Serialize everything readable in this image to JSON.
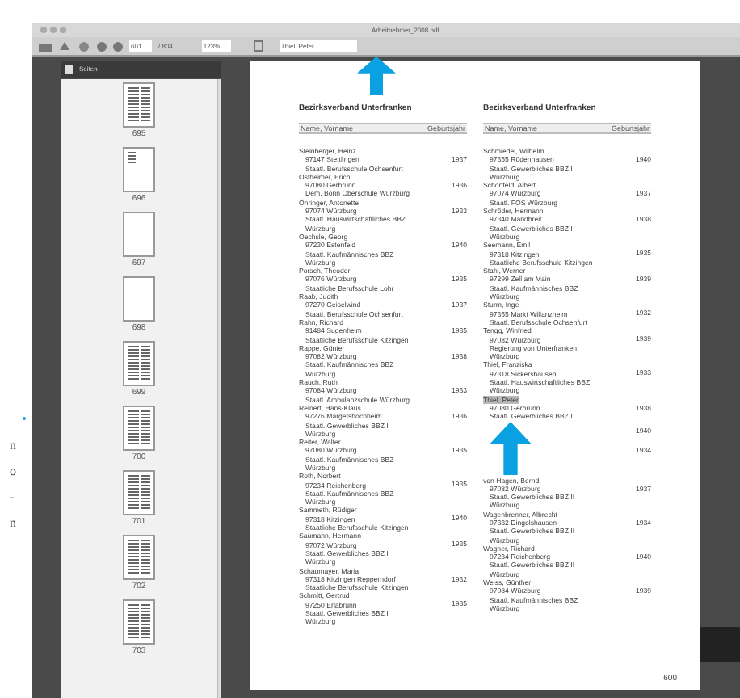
{
  "window": {
    "title": "Arbeitnehmer_2008.pdf"
  },
  "toolbar": {
    "page": "601",
    "page_count": "/ 804",
    "zoom": "123%",
    "search": "Thiel, Peter"
  },
  "sidebar": {
    "title": "Seiten",
    "thumbnails": [
      {
        "label": "695",
        "kind": "list"
      },
      {
        "label": "696",
        "kind": "partial"
      },
      {
        "label": "697",
        "kind": "blank"
      },
      {
        "label": "698",
        "kind": "blank"
      },
      {
        "label": "699",
        "kind": "list"
      },
      {
        "label": "700",
        "kind": "list"
      },
      {
        "label": "701",
        "kind": "list"
      },
      {
        "label": "702",
        "kind": "list"
      },
      {
        "label": "703",
        "kind": "list"
      }
    ]
  },
  "margin_fragments": [
    "n",
    "o",
    "-",
    "n"
  ],
  "document": {
    "page_number": "600",
    "columns": [
      {
        "heading": "Bezirksverband Unterfranken",
        "header_left": "Name, Vorname",
        "header_right": "Geburtsjahr",
        "entries": [
          {
            "lines": [
              "Steinberger, Heinz",
              "97147 Stettlingen",
              "Staatl. Berufsschule Ochsenfurt"
            ],
            "year": "1937",
            "highlighted": false
          },
          {
            "lines": [
              "Ostheimer, Erich",
              "97080 Gerbrunn",
              "Dem. Bonn Oberschule Würzburg"
            ],
            "year": "1936",
            "highlighted": false
          },
          {
            "lines": [
              "Öhringer, Antonette",
              "97074 Würzburg",
              "Staatl. Hauswirtschaftliches BBZ",
              "Würzburg"
            ],
            "year": "1933",
            "highlighted": false
          },
          {
            "lines": [
              "Oechsle, Georg",
              "97230 Estenfeld",
              "Staatl. Kaufmännisches BBZ",
              "Würzburg"
            ],
            "year": "1940",
            "highlighted": false
          },
          {
            "lines": [
              "Porsch, Theodor",
              "97076 Würzburg",
              "Staatliche Berufsschule Lohr"
            ],
            "year": "1935",
            "highlighted": false
          },
          {
            "lines": [
              "Raab, Judith",
              "97270 Geiselwind",
              "Staatl. Berufsschule Ochsenfurt"
            ],
            "year": "1937",
            "highlighted": false
          },
          {
            "lines": [
              "Rahn, Richard",
              "91484 Sugenheim",
              "Staatliche Berufsschule Kitzingen"
            ],
            "year": "1935",
            "highlighted": false
          },
          {
            "lines": [
              "Rappe, Günter",
              "97082 Würzburg",
              "Staatl. Kaufmännisches BBZ",
              "Würzburg"
            ],
            "year": "1938",
            "highlighted": false
          },
          {
            "lines": [
              "Rauch, Ruth",
              "97084 Würzburg",
              "Staatl. Ambulanzschule Würzburg"
            ],
            "year": "1933",
            "highlighted": false
          },
          {
            "lines": [
              "Reinert, Hans-Klaus",
              "97276 Margetshöchheim",
              "Staatl. Gewerbliches BBZ I",
              "Würzburg"
            ],
            "year": "1936",
            "highlighted": false
          },
          {
            "lines": [
              "Reiter, Walter",
              "97080 Würzburg",
              "Staatl. Kaufmännisches BBZ",
              "Würzburg"
            ],
            "year": "1935",
            "highlighted": false
          },
          {
            "lines": [
              "Roth, Norbert",
              "97234 Reichenberg",
              "Staatl. Kaufmännisches BBZ",
              "Würzburg"
            ],
            "year": "1935",
            "highlighted": false
          },
          {
            "lines": [
              "Sammeth, Rüdiger",
              "97318 Kitzingen",
              "Staatliche Berufsschule Kitzingen"
            ],
            "year": "1940",
            "highlighted": false
          },
          {
            "lines": [
              "Saumann, Hermann",
              "97072 Würzburg",
              "Staatl. Gewerbliches BBZ I",
              "Würzburg"
            ],
            "year": "1935",
            "highlighted": false
          },
          {
            "lines": [
              "Schaumayer, Maria",
              "97318 Kitzingen Repperndorf",
              "Staatliche Berufsschule Kitzingen"
            ],
            "year": "1932",
            "highlighted": false
          },
          {
            "lines": [
              "Schmitt, Gertrud",
              "97250 Erlabrunn",
              "Staatl. Gewerbliches BBZ I",
              "Würzburg"
            ],
            "year": "1935",
            "highlighted": false
          }
        ]
      },
      {
        "heading": "Bezirksverband Unterfranken",
        "header_left": "Name, Vorname",
        "header_right": "Geburtsjahr",
        "entries": [
          {
            "lines": [
              "Schmiedel, Wilhelm",
              "97355 Rüdenhausen",
              "Staatl. Gewerbliches BBZ I",
              "Würzburg"
            ],
            "year": "1940",
            "highlighted": false
          },
          {
            "lines": [
              "Schönfeld, Albert",
              "97074 Würzburg",
              "Staatl. FOS Würzburg"
            ],
            "year": "1937",
            "highlighted": false
          },
          {
            "lines": [
              "Schröder, Hermann",
              "97340 Marktbreit",
              "Staatl. Gewerbliches BBZ I",
              "Würzburg"
            ],
            "year": "1938",
            "highlighted": false
          },
          {
            "lines": [
              "Seemann, Emil",
              "97318 Kitzingen",
              "Staatliche Berufsschule Kitzingen"
            ],
            "year": "1935",
            "highlighted": false
          },
          {
            "lines": [
              "Stahl, Werner",
              "97299 Zell am Main",
              "Staatl. Kaufmännisches BBZ",
              "Würzburg"
            ],
            "year": "1939",
            "highlighted": false
          },
          {
            "lines": [
              "Sturm, Inge",
              "97355 Markt Willanzheim",
              "Staatl. Berufsschule Ochsenfurt"
            ],
            "year": "1932",
            "highlighted": false
          },
          {
            "lines": [
              "Tengg, Winfried",
              "97082 Würzburg",
              "Regierung von Unterfranken",
              "Würzburg"
            ],
            "year": "1939",
            "highlighted": false
          },
          {
            "lines": [
              "Thiel, Franziska",
              "97318 Sickershausen",
              "Staatl. Hauswirtschaftliches BBZ",
              "Würzburg"
            ],
            "year": "1933",
            "highlighted": false
          },
          {
            "lines": [
              "Thiel, Peter",
              "97080 Gerbrunn",
              "Staatl. Gewerbliches BBZ I"
            ],
            "year": "1938",
            "highlighted": true
          },
          {
            "year": "1940",
            "highlighted": false
          },
          {
            "year": "1934",
            "highlighted": false
          },
          {
            "lines": [
              "von Hagen, Bernd",
              "97082 Würzburg",
              "Staatl. Gewerbliches BBZ II",
              "Würzburg"
            ],
            "year": "1937",
            "highlighted": false
          },
          {
            "lines": [
              "Wagenbrenner, Albrecht",
              "97332 Dingolshausen",
              "Staatl. Gewerbliches BBZ II",
              "Würzburg"
            ],
            "year": "1934",
            "highlighted": false
          },
          {
            "lines": [
              "Wagner, Richard",
              "97234 Reichenberg",
              "Staatl. Gewerbliches BBZ II",
              "Würzburg"
            ],
            "year": "1940",
            "highlighted": false
          },
          {
            "lines": [
              "Weiss, Günther",
              "97084 Würzburg",
              "Staatl. Kaufmännisches BBZ",
              "Würzburg"
            ],
            "year": "1939",
            "highlighted": false
          }
        ]
      }
    ]
  }
}
